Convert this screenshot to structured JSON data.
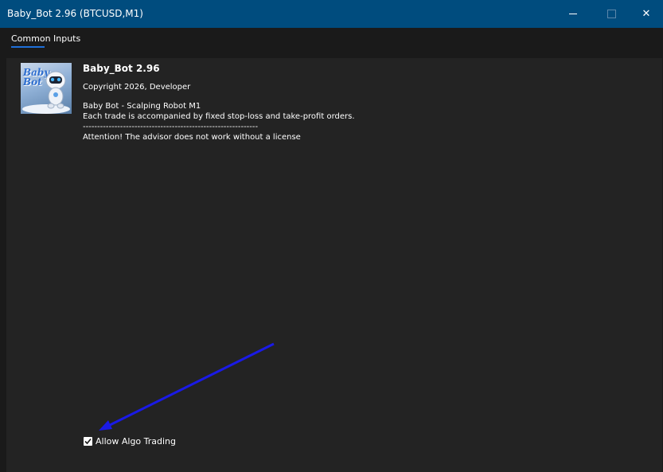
{
  "window": {
    "title": "Baby_Bot 2.96 (BTCUSD,M1)",
    "close_glyph": "✕"
  },
  "tabs": [
    {
      "label": "Common",
      "active": true
    },
    {
      "label": "Inputs",
      "active": false
    }
  ],
  "expert": {
    "logo_text": "Baby Bot",
    "name": "Baby_Bot 2.96",
    "copyright": "Copyright 2026, Developer",
    "description_lines": [
      "Baby Bot - Scalping Robot M1",
      "Each trade is accompanied by fixed stop-loss and take-profit orders.",
      "-------------------------------------------------------------",
      "Attention! The advisor does not work without a license"
    ]
  },
  "algo_trading": {
    "label": "Allow Algo Trading",
    "checked": true
  },
  "colors": {
    "titlebar": "#004c7e",
    "tab_accent": "#1e6fd9",
    "annotation_arrow": "#1a1ae6"
  }
}
